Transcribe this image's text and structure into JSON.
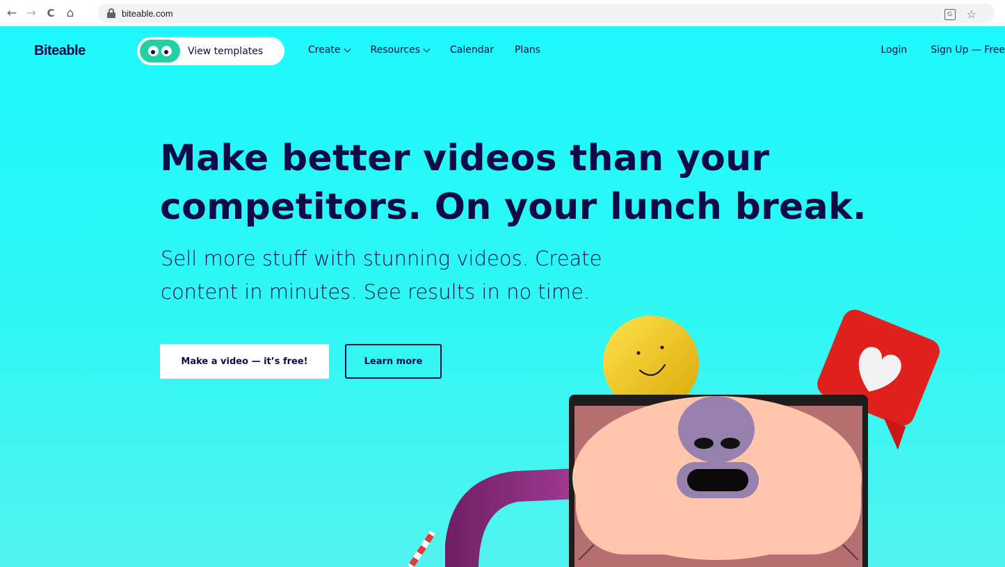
{
  "browser": {
    "url": "biteable.com",
    "nav": {
      "back": "←",
      "forward": "→",
      "reload": "C",
      "home": "⌂"
    },
    "translate_glyph": "G",
    "bookmark_glyph": "☆"
  },
  "site_nav": {
    "logo": "Biteable",
    "templates_button": "View templates",
    "links": [
      "Create",
      "Resources",
      "Calendar",
      "Plans"
    ],
    "login": "Login",
    "signup": "Sign Up — Free"
  },
  "hero": {
    "title_line1": "Make better videos than your",
    "title_line2": "competitors. On your lunch break.",
    "subtitle_line1": "Sell more stuff with stunning videos. Create",
    "subtitle_line2": "content in minutes. See results in no time.",
    "cta_primary": "Make a video — it’s free!",
    "cta_secondary": "Learn more"
  },
  "colors": {
    "background": "#1ef8fd",
    "text_navy": "#0e0b47",
    "pill_green": "#1fd1a4",
    "heart_red": "#e0201c",
    "ball_yellow": "#f2cc16",
    "face_skin": "#ffc5ad",
    "arch_purple": "#8a2b7d"
  }
}
